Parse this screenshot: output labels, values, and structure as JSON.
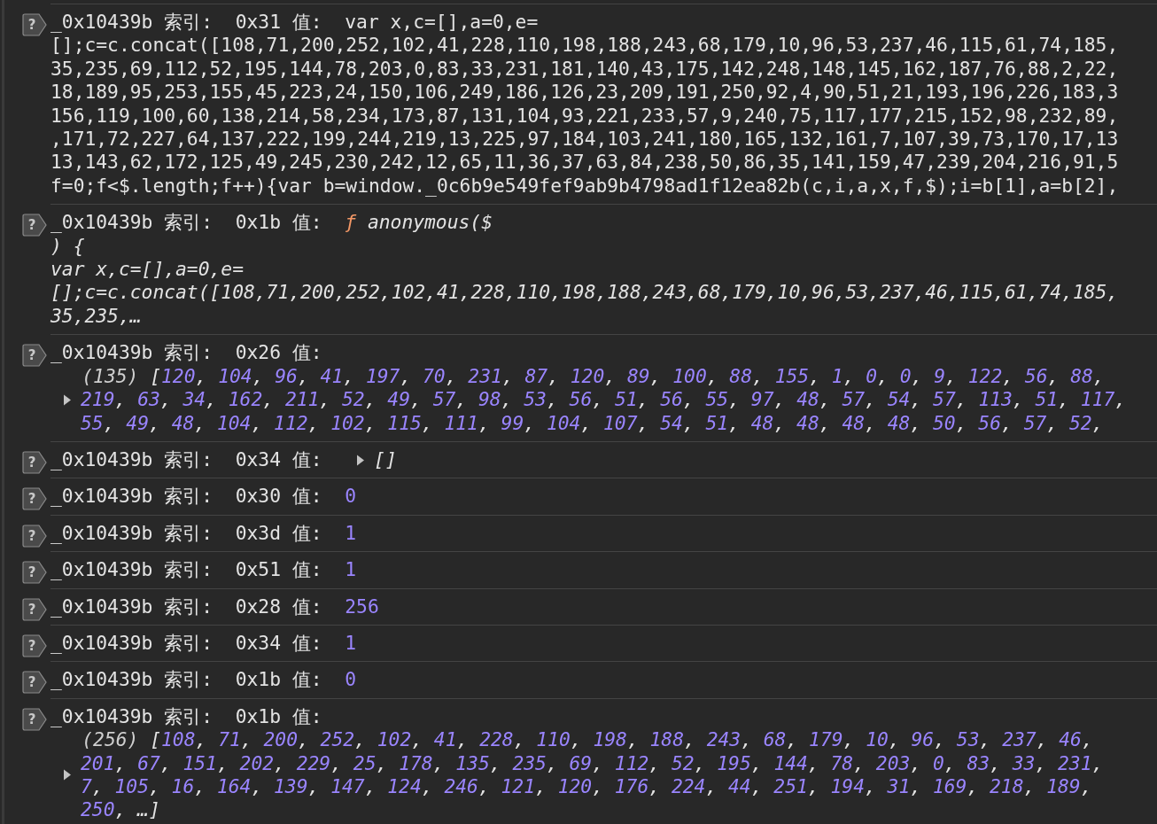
{
  "entries": [
    {
      "badge": "?",
      "name": "_0x10439b 索引:",
      "index": "0x31",
      "value_label": "值:",
      "kind": "string",
      "lines": [
        "var x,c=[],a=0,e=",
        "[];c=c.concat([108,71,200,252,102,41,228,110,198,188,243,68,179,10,96,53,237,46,115,61,74,185,",
        "35,235,69,112,52,195,144,78,203,0,83,33,231,181,140,43,175,142,248,148,145,162,187,76,88,2,22,",
        "18,189,95,253,155,45,223,24,150,106,249,186,126,23,209,191,250,92,4,90,51,21,193,196,226,183,3",
        "156,119,100,60,138,214,58,234,173,87,131,104,93,221,233,57,9,240,75,117,177,215,152,98,232,89,",
        ",171,72,227,64,137,222,199,244,219,13,225,97,184,103,241,180,165,132,161,7,107,39,73,170,17,13",
        "13,143,62,172,125,49,245,230,242,12,65,11,36,37,63,84,238,50,86,35,141,159,47,239,204,216,91,5",
        "f=0;f<$.length;f++){var b=window._0c6b9e549fef9ab9b4798ad1f12ea82b(c,i,a,x,f,$);i=b[1],a=b[2],"
      ]
    },
    {
      "badge": "?",
      "name": "_0x10439b 索引:",
      "index": "0x1b",
      "value_label": "值:",
      "kind": "function",
      "keyword": "ƒ",
      "lines": [
        "anonymous($",
        ") {",
        "var x,c=[],a=0,e=",
        "[];c=c.concat([108,71,200,252,102,41,228,110,198,188,243,68,179,10,96,53,237,46,115,61,74,185,",
        "35,235,…"
      ]
    },
    {
      "badge": "?",
      "name": "_0x10439b 索引:",
      "index": "0x26",
      "value_label": "值:",
      "kind": "array",
      "length": "(135)",
      "expanded": false,
      "lines": [
        "[120, 104, 96, 41, 197, 70, 231, 87, 120, 89, 100, 88, 155, 1, 0, 0, 9, 122, 56, 88,",
        "219, 63, 34, 162, 211, 52, 49, 57, 98, 53, 56, 51, 56, 55, 97, 48, 57, 54, 57, 113, 51, 117,",
        "55, 49, 48, 104, 112, 102, 115, 111, 99, 104, 107, 54, 51, 48, 48, 48, 48, 50, 56, 57, 52,"
      ]
    },
    {
      "badge": "?",
      "name": "_0x10439b 索引:",
      "index": "0x34",
      "value_label": "值:",
      "kind": "inline-array",
      "expanded": false,
      "text": "[]"
    },
    {
      "badge": "?",
      "name": "_0x10439b 索引:",
      "index": "0x30",
      "value_label": "值:",
      "kind": "number",
      "text": "0"
    },
    {
      "badge": "?",
      "name": "_0x10439b 索引:",
      "index": "0x3d",
      "value_label": "值:",
      "kind": "number",
      "text": "1"
    },
    {
      "badge": "?",
      "name": "_0x10439b 索引:",
      "index": "0x51",
      "value_label": "值:",
      "kind": "number",
      "text": "1"
    },
    {
      "badge": "?",
      "name": "_0x10439b 索引:",
      "index": "0x28",
      "value_label": "值:",
      "kind": "number",
      "text": "256"
    },
    {
      "badge": "?",
      "name": "_0x10439b 索引:",
      "index": "0x34",
      "value_label": "值:",
      "kind": "number",
      "text": "1"
    },
    {
      "badge": "?",
      "name": "_0x10439b 索引:",
      "index": "0x1b",
      "value_label": "值:",
      "kind": "number",
      "text": "0"
    },
    {
      "badge": "?",
      "name": "_0x10439b 索引:",
      "index": "0x1b",
      "value_label": "值:",
      "kind": "array",
      "length": "(256)",
      "expanded": false,
      "lines": [
        "[108, 71, 200, 252, 102, 41, 228, 110, 198, 188, 243, 68, 179, 10, 96, 53, 237, 46,",
        "201, 67, 151, 202, 229, 25, 178, 135, 235, 69, 112, 52, 195, 144, 78, 203, 0, 83, 33, 231,",
        "7, 105, 16, 164, 139, 147, 124, 246, 121, 120, 176, 224, 44, 251, 194, 31, 169, 218, 189,",
        "250, …]"
      ]
    }
  ]
}
